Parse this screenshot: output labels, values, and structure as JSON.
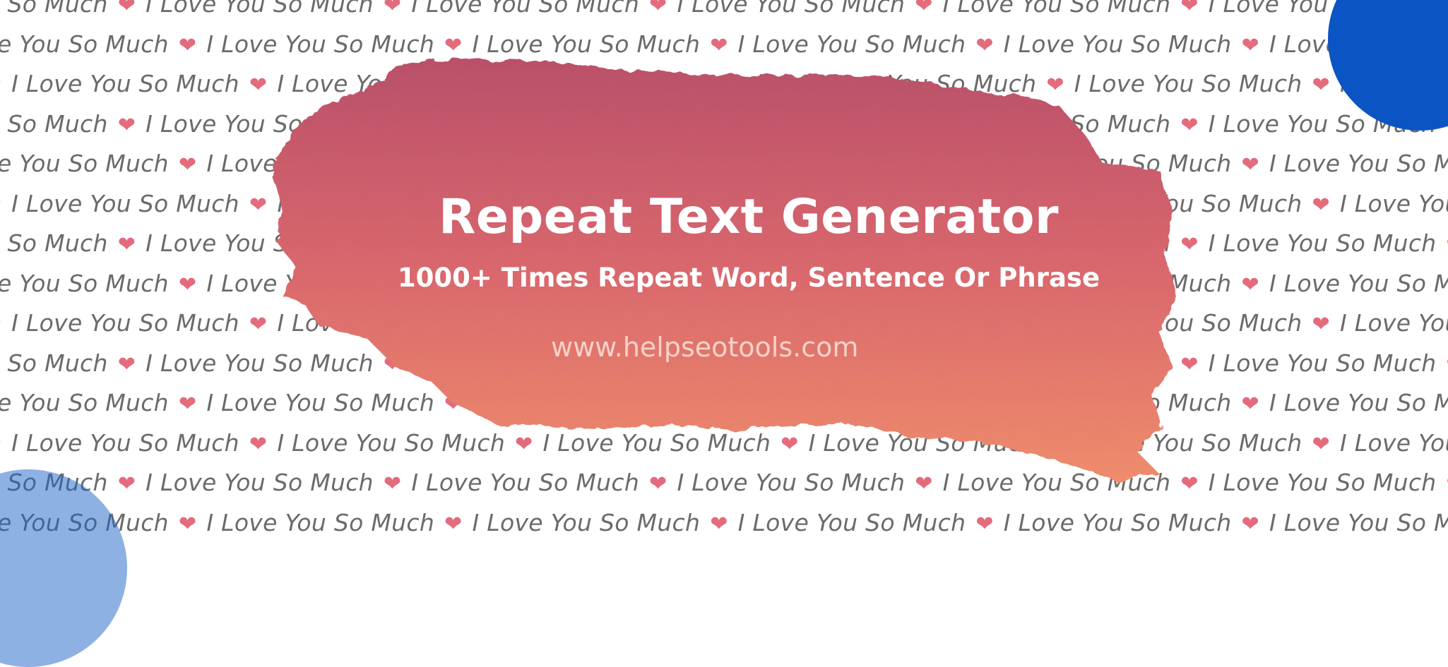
{
  "banner": {
    "title": "Repeat Text Generator",
    "subtitle": "1000+ Times Repeat Word, Sentence Or Phrase",
    "website": "www.helpseotools.com"
  },
  "background": {
    "repeated_phrase": "I Love You So Much",
    "separator_icon": "sparkling-heart-icon",
    "separator_glyph": "❤"
  },
  "colors": {
    "brush_top": "#b9506a",
    "brush_mid": "#d9676d",
    "brush_bottom": "#ee8c6c",
    "circle_top_right": "#0b54c4",
    "circle_bottom_left": "#1e64c8",
    "bg_text": "#6b6b6b",
    "heart": "#e36b7c"
  }
}
